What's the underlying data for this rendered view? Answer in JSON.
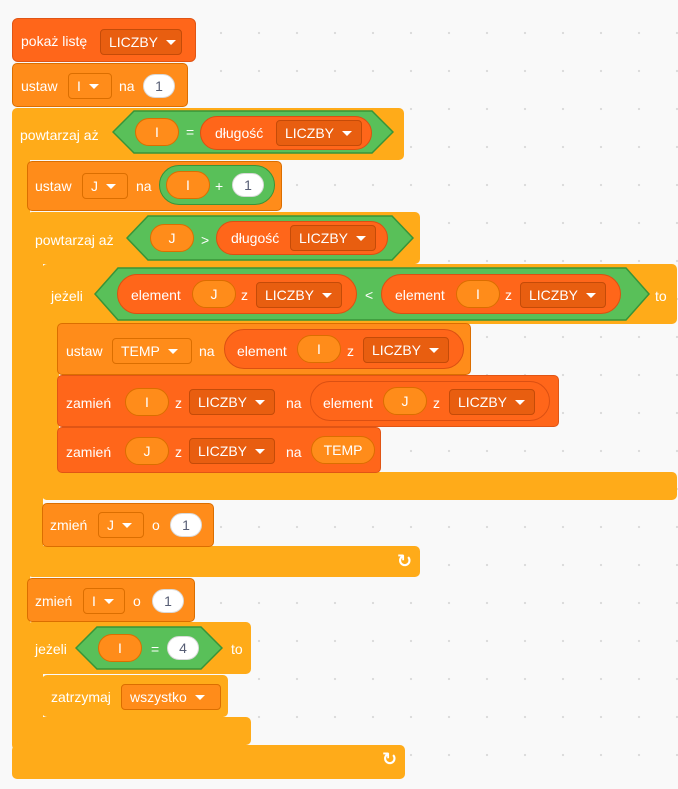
{
  "workspace": {
    "show_list": {
      "label": "pokaż listę",
      "list": "LICZBY"
    },
    "set_i": {
      "label": "ustaw",
      "var": "I",
      "to": "na",
      "value": "1"
    },
    "repeat_outer": {
      "label": "powtarzaj aż",
      "left": "I",
      "op": "=",
      "length_label": "długość",
      "length_list": "LICZBY"
    },
    "set_j": {
      "label": "ustaw",
      "var": "J",
      "to": "na",
      "left": "I",
      "op": "+",
      "right": "1"
    },
    "repeat_inner": {
      "label": "powtarzaj aż",
      "left": "J",
      "op": ">",
      "length_label": "długość",
      "length_list": "LICZBY"
    },
    "if_compare": {
      "label": "jeżeli",
      "item_label": "element",
      "left_index": "J",
      "of": "z",
      "left_list": "LICZBY",
      "op": "<",
      "right_index": "I",
      "right_list": "LICZBY",
      "then": "to"
    },
    "set_temp": {
      "label": "ustaw",
      "var": "TEMP",
      "to": "na",
      "item_label": "element",
      "index": "I",
      "of": "z",
      "list": "LICZBY"
    },
    "replace_i": {
      "label": "zamień",
      "index": "I",
      "of": "z",
      "list": "LICZBY",
      "with": "na",
      "item_label": "element",
      "item_index": "J",
      "item_list": "LICZBY"
    },
    "replace_j": {
      "label": "zamień",
      "index": "J",
      "of": "z",
      "list": "LICZBY",
      "with": "na",
      "value": "TEMP"
    },
    "change_j": {
      "label": "zmień",
      "var": "J",
      "by": "o",
      "value": "1"
    },
    "change_i": {
      "label": "zmień",
      "var": "I",
      "by": "o",
      "value": "1"
    },
    "if_equal": {
      "label": "jeżeli",
      "left": "I",
      "op": "=",
      "right": "4",
      "then": "to"
    },
    "stop": {
      "label": "zatrzymaj",
      "option": "wszystko"
    },
    "loop_arrow": "↻"
  },
  "colors": {
    "control": "#ffab19",
    "list": "#ff661a",
    "variable": "#ff8c1a",
    "operator": "#59c059",
    "background": "#f9f9f9"
  }
}
